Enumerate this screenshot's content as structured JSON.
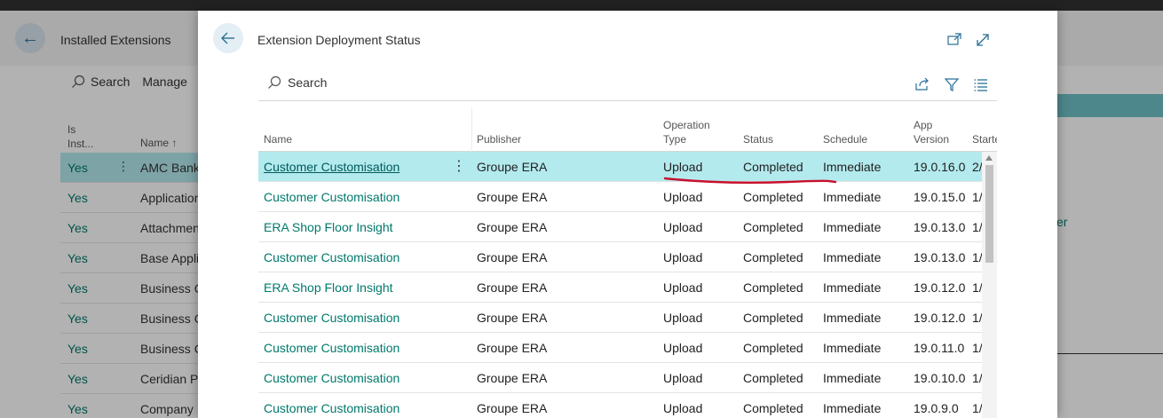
{
  "background": {
    "title": "Installed Extensions",
    "search_label": "Search",
    "manage_label": "Manage",
    "header_installed": "Is Inst...",
    "header_name": "Name ↑",
    "right_link": "er",
    "rows": [
      {
        "installed": "Yes",
        "name": "AMC Bank"
      },
      {
        "installed": "Yes",
        "name": "Application"
      },
      {
        "installed": "Yes",
        "name": "Attachment"
      },
      {
        "installed": "Yes",
        "name": "Base Appli"
      },
      {
        "installed": "Yes",
        "name": "Business C"
      },
      {
        "installed": "Yes",
        "name": "Business C"
      },
      {
        "installed": "Yes",
        "name": "Business C"
      },
      {
        "installed": "Yes",
        "name": "Ceridian P"
      },
      {
        "installed": "Yes",
        "name": "Company"
      }
    ]
  },
  "dialog": {
    "title": "Extension Deployment Status",
    "search_label": "Search",
    "columns": {
      "name": "Name",
      "publisher": "Publisher",
      "operation_type": "Operation Type",
      "status": "Status",
      "schedule": "Schedule",
      "app_version": "App Version",
      "started": "Starte"
    },
    "rows": [
      {
        "name": "Customer Customisation",
        "publisher": "Groupe ERA",
        "operation": "Upload",
        "status": "Completed",
        "schedule": "Immediate",
        "version": "19.0.16.0",
        "started": "2/"
      },
      {
        "name": "Customer Customisation",
        "publisher": "Groupe ERA",
        "operation": "Upload",
        "status": "Completed",
        "schedule": "Immediate",
        "version": "19.0.15.0",
        "started": "1/"
      },
      {
        "name": "ERA Shop Floor Insight",
        "publisher": "Groupe ERA",
        "operation": "Upload",
        "status": "Completed",
        "schedule": "Immediate",
        "version": "19.0.13.0",
        "started": "1/"
      },
      {
        "name": "Customer Customisation",
        "publisher": "Groupe ERA",
        "operation": "Upload",
        "status": "Completed",
        "schedule": "Immediate",
        "version": "19.0.13.0",
        "started": "1/"
      },
      {
        "name": "ERA Shop Floor Insight",
        "publisher": "Groupe ERA",
        "operation": "Upload",
        "status": "Completed",
        "schedule": "Immediate",
        "version": "19.0.12.0",
        "started": "1/"
      },
      {
        "name": "Customer Customisation",
        "publisher": "Groupe ERA",
        "operation": "Upload",
        "status": "Completed",
        "schedule": "Immediate",
        "version": "19.0.12.0",
        "started": "1/"
      },
      {
        "name": "Customer Customisation",
        "publisher": "Groupe ERA",
        "operation": "Upload",
        "status": "Completed",
        "schedule": "Immediate",
        "version": "19.0.11.0",
        "started": "1/"
      },
      {
        "name": "Customer Customisation",
        "publisher": "Groupe ERA",
        "operation": "Upload",
        "status": "Completed",
        "schedule": "Immediate",
        "version": "19.0.10.0",
        "started": "1/"
      },
      {
        "name": "Customer Customisation",
        "publisher": "Groupe ERA",
        "operation": "Upload",
        "status": "Completed",
        "schedule": "Immediate",
        "version": "19.0.9.0",
        "started": "1/"
      }
    ]
  },
  "colors": {
    "accent": "#00796b",
    "selected_row": "#b3eaee",
    "annotation": "#c8102e"
  },
  "icons": [
    "back-arrow-icon",
    "open-new-window-icon",
    "expand-icon",
    "search-icon",
    "share-icon",
    "filter-icon",
    "list-view-icon",
    "more-options-icon"
  ]
}
